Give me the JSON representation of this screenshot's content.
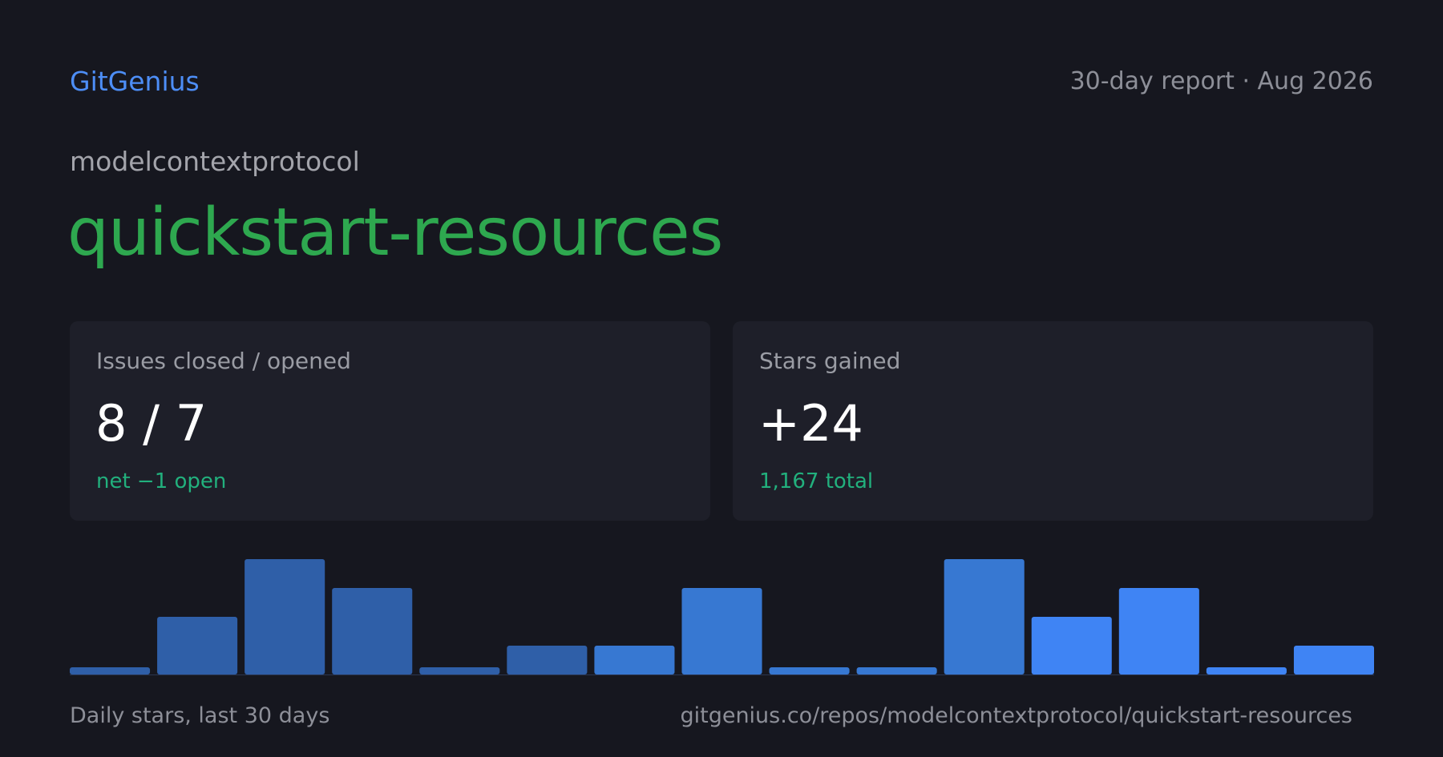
{
  "header": {
    "brand": "GitGenius",
    "report_label": "30-day report · Aug 2026"
  },
  "repo": {
    "owner": "modelcontextprotocol",
    "name": "quickstart-resources"
  },
  "cards": {
    "issues": {
      "label": "Issues closed / opened",
      "value": "8 / 7",
      "sub": "net −1 open"
    },
    "stars": {
      "label": "Stars gained",
      "value": "+24",
      "sub": "1,167 total"
    }
  },
  "colors": {
    "background": "#16171f",
    "card": "#1e1f29",
    "brand": "#4d8ef7",
    "repo_name": "#2ea84f",
    "positive": "#22b07d",
    "muted": "#8d8f98",
    "bar_dark": "#2f5fa8",
    "bar_mid": "#3778d2",
    "bar_bright": "#3f84f4"
  },
  "chart_data": {
    "type": "bar",
    "values": [
      0.25,
      2,
      4,
      3,
      0.25,
      1,
      1,
      3,
      0.25,
      0.25,
      4,
      2,
      3,
      0.25,
      1
    ],
    "bar_colors": [
      "#2f5fa8",
      "#2f5fa8",
      "#2f5fa8",
      "#2f5fa8",
      "#2f5fa8",
      "#2f5fa8",
      "#3778d2",
      "#3778d2",
      "#3778d2",
      "#3778d2",
      "#3778d2",
      "#3f84f4",
      "#3f84f4",
      "#3f84f4",
      "#3f84f4"
    ],
    "ylim": [
      0,
      4
    ],
    "grid": false,
    "legend": "none"
  },
  "footer": {
    "caption": "Daily stars, last 30 days",
    "url": "gitgenius.co/repos/modelcontextprotocol/quickstart-resources"
  }
}
